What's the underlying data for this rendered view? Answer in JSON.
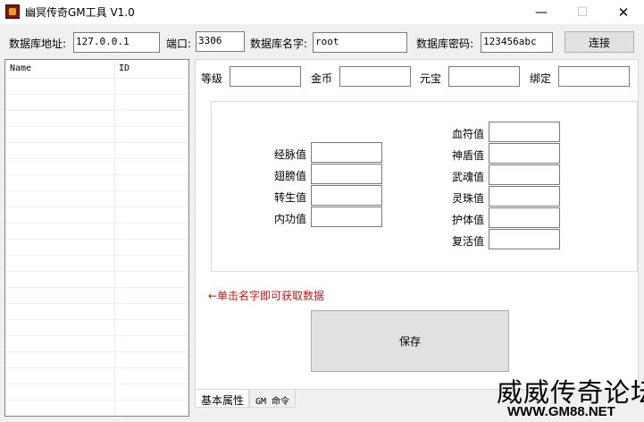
{
  "window": {
    "title": "幽冥传奇GM工具 V1.0",
    "minimize_glyph": "—",
    "maximize_glyph": "☐",
    "close_glyph": "✕"
  },
  "connection": {
    "host_label": "数据库地址:",
    "host_value": "127.0.0.1",
    "port_label": "端口:",
    "port_value": "3306",
    "dbname_label": "数据库名字:",
    "dbname_value": "root",
    "password_label": "数据库密码:",
    "password_value": "123456abc",
    "connect_button": "连接"
  },
  "player_list": {
    "columns": [
      "Name",
      "ID"
    ],
    "rows": []
  },
  "basic": {
    "level_label": "等级",
    "gold_label": "金币",
    "yuanbao_label": "元宝",
    "bound_label": "绑定"
  },
  "attributes": {
    "left": [
      "经脉值",
      "翅膀值",
      "转生值",
      "内功值"
    ],
    "right": [
      "血符值",
      "神盾值",
      "武魂值",
      "灵珠值",
      "护体值",
      "复活值"
    ]
  },
  "hint": "←单击名字即可获取数据",
  "save_button": "保存",
  "tabs": [
    "基本属性",
    "GM 命令"
  ],
  "watermark": {
    "title": "威威传奇论坛",
    "url": "WWW.GM88.NET"
  }
}
